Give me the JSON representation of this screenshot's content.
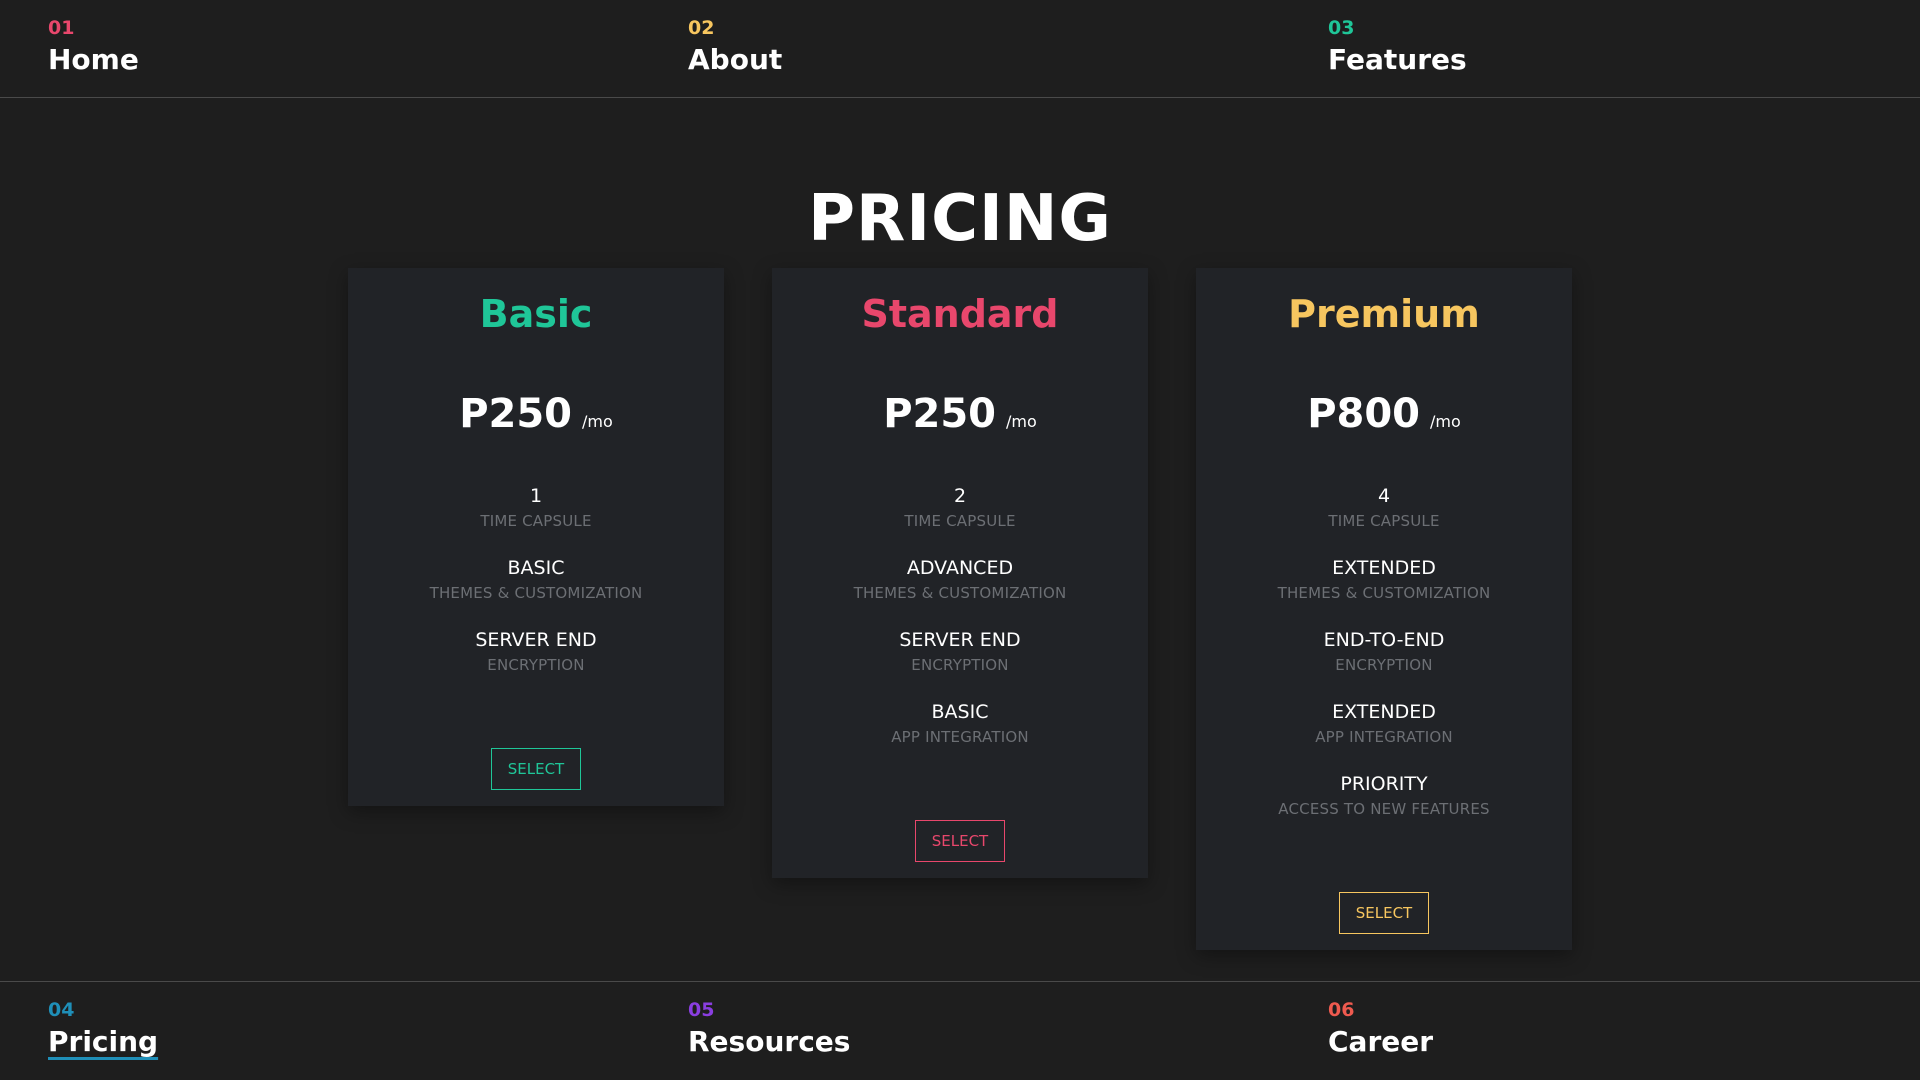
{
  "colors": {
    "background": "#1e1e1e",
    "card": "#212327",
    "green": "#1fc698",
    "red": "#e8476c",
    "yellow": "#f7c65f",
    "blue": "#1f8fb8",
    "purple": "#8a3ee0",
    "orange_red": "#ee5a4f",
    "muted_text": "#6c6f74"
  },
  "nav_top": [
    {
      "num": "01",
      "label": "Home",
      "color": "#e8476c"
    },
    {
      "num": "02",
      "label": "About",
      "color": "#f7c65f"
    },
    {
      "num": "03",
      "label": "Features",
      "color": "#1fc698"
    }
  ],
  "nav_bottom": [
    {
      "num": "04",
      "label": "Pricing",
      "color": "#1f8fb8",
      "active": true
    },
    {
      "num": "05",
      "label": "Resources",
      "color": "#8a3ee0"
    },
    {
      "num": "06",
      "label": "Career",
      "color": "#ee5a4f"
    }
  ],
  "title": "PRICING",
  "plans": [
    {
      "name": "Basic",
      "color": "#1fc698",
      "price": "P250",
      "period": "/mo",
      "features": [
        {
          "value": "1",
          "label": "TIME CAPSULE"
        },
        {
          "value": "BASIC",
          "label": "THEMES & CUSTOMIZATION"
        },
        {
          "value": "SERVER END",
          "label": "ENCRYPTION"
        }
      ],
      "button": "SELECT"
    },
    {
      "name": "Standard",
      "color": "#e8476c",
      "price": "P250",
      "period": "/mo",
      "features": [
        {
          "value": "2",
          "label": "TIME CAPSULE"
        },
        {
          "value": "ADVANCED",
          "label": "THEMES & CUSTOMIZATION"
        },
        {
          "value": "SERVER END",
          "label": "ENCRYPTION"
        },
        {
          "value": "BASIC",
          "label": "APP INTEGRATION"
        }
      ],
      "button": "SELECT"
    },
    {
      "name": "Premium",
      "color": "#f7c65f",
      "price": "P800",
      "period": "/mo",
      "features": [
        {
          "value": "4",
          "label": "TIME CAPSULE"
        },
        {
          "value": "EXTENDED",
          "label": "THEMES & CUSTOMIZATION"
        },
        {
          "value": "END-TO-END",
          "label": "ENCRYPTION"
        },
        {
          "value": "EXTENDED",
          "label": "APP INTEGRATION"
        },
        {
          "value": "PRIORITY",
          "label": "ACCESS TO NEW FEATURES"
        }
      ],
      "button": "SELECT"
    }
  ]
}
